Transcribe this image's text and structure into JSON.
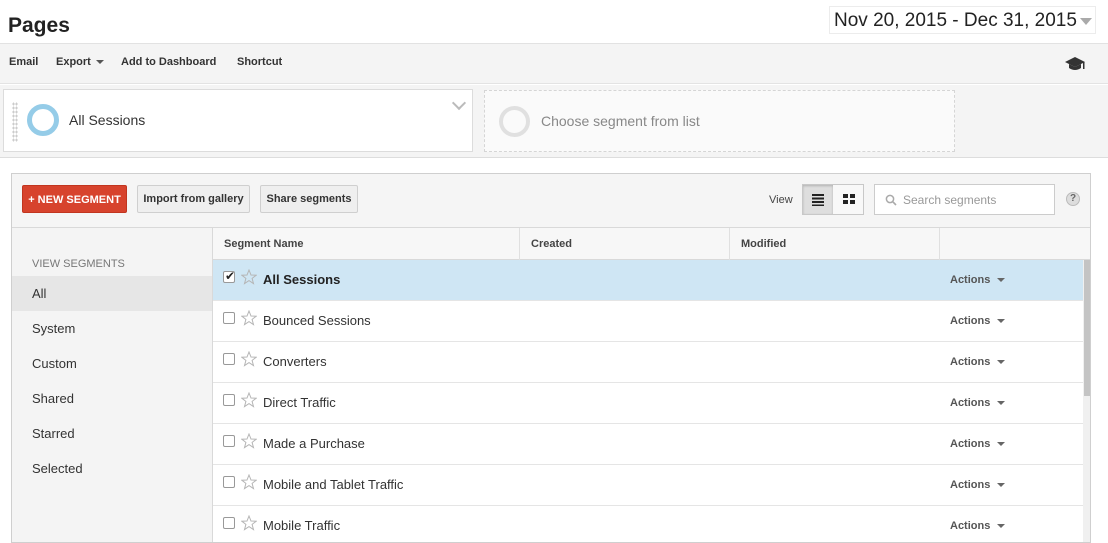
{
  "header": {
    "title": "Pages",
    "date_range": "Nov 20, 2015 - Dec 31, 2015"
  },
  "toolbar": {
    "email": "Email",
    "export": "Export",
    "add_to_dashboard": "Add to Dashboard",
    "shortcut": "Shortcut",
    "help_icon": "graduation-cap-icon"
  },
  "segment_bar": {
    "active_segment": "All Sessions",
    "choose_placeholder": "Choose segment from list"
  },
  "panel": {
    "new_segment": "+ NEW SEGMENT",
    "import_gallery": "Import from gallery",
    "share_segments": "Share segments",
    "view_label": "View",
    "search_placeholder": "Search segments",
    "help": "?"
  },
  "nav": {
    "heading": "VIEW SEGMENTS",
    "items": [
      "All",
      "System",
      "Custom",
      "Shared",
      "Starred",
      "Selected"
    ],
    "active": "All"
  },
  "table": {
    "columns": [
      "Segment Name",
      "Created",
      "Modified"
    ],
    "actions_label": "Actions",
    "rows": [
      {
        "name": "All Sessions",
        "checked": true
      },
      {
        "name": "Bounced Sessions",
        "checked": false
      },
      {
        "name": "Converters",
        "checked": false
      },
      {
        "name": "Direct Traffic",
        "checked": false
      },
      {
        "name": "Made a Purchase",
        "checked": false
      },
      {
        "name": "Mobile and Tablet Traffic",
        "checked": false
      },
      {
        "name": "Mobile Traffic",
        "checked": false
      }
    ]
  },
  "colors": {
    "accent_red": "#d7432d",
    "selected_row": "#cfe6f4",
    "segment_ring": "#95cce8"
  }
}
